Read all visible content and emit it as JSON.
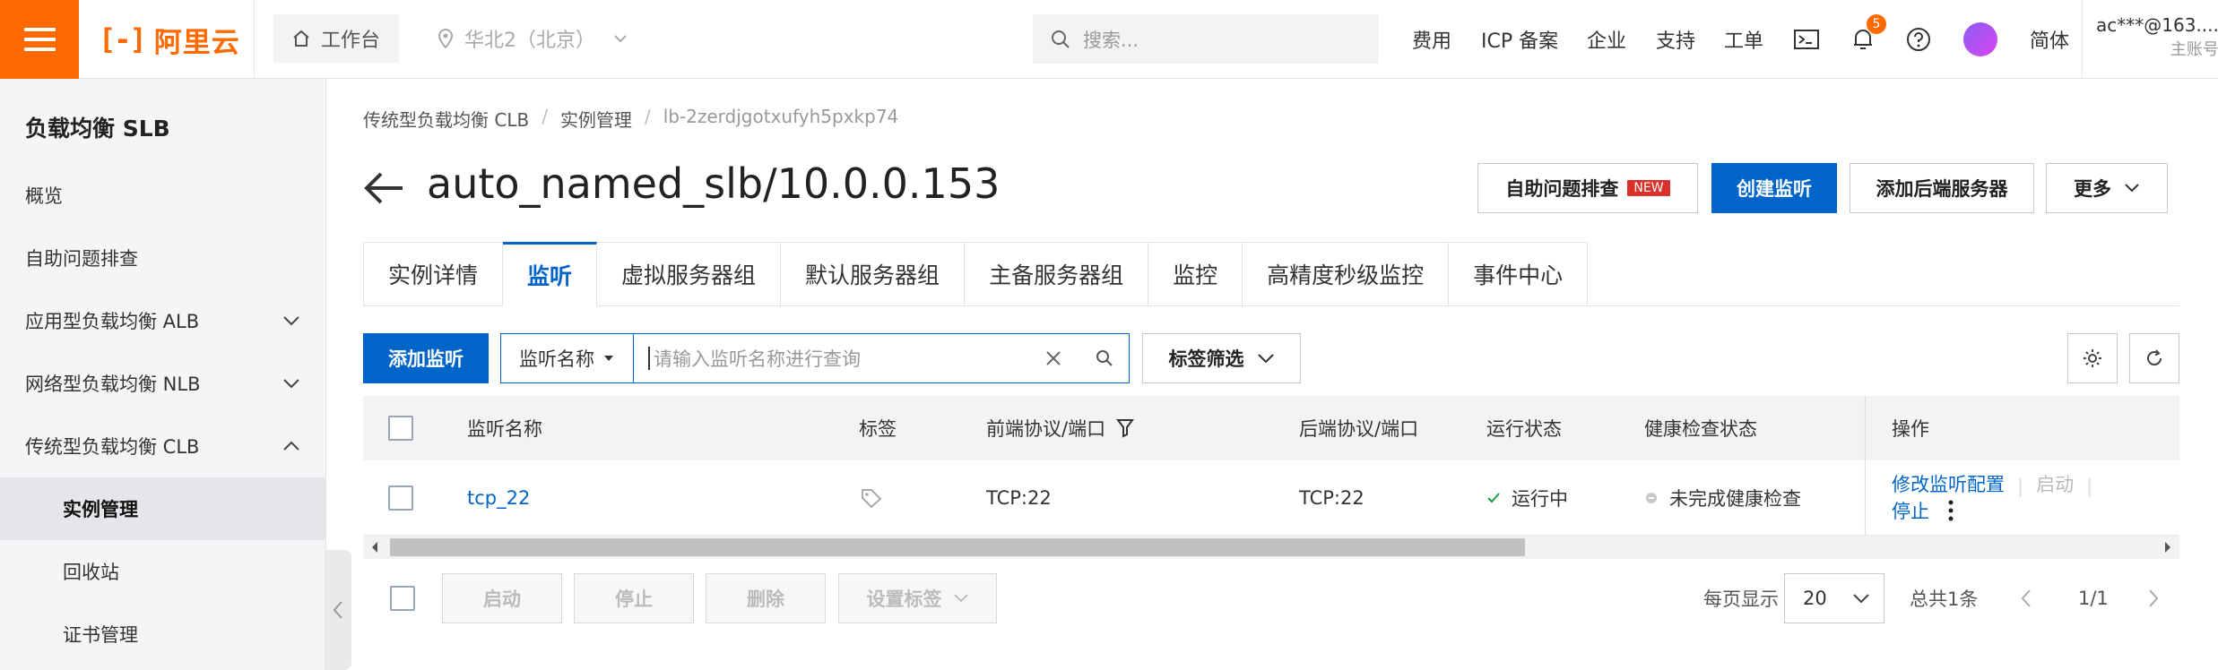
{
  "topbar": {
    "logo_mark": "[-]",
    "logo_text": "阿里云",
    "workbench": "工作台",
    "region": "华北2（北京）",
    "search_placeholder": "搜索...",
    "nav": [
      "费用",
      "ICP 备案",
      "企业",
      "支持",
      "工单"
    ],
    "notification_count": "5",
    "language": "简体",
    "account_name": "ac***@163....",
    "account_type": "主账号"
  },
  "sidebar": {
    "title": "负载均衡 SLB",
    "items": [
      {
        "label": "概览"
      },
      {
        "label": "自助问题排查"
      },
      {
        "label": "应用型负载均衡 ALB"
      },
      {
        "label": "网络型负载均衡 NLB"
      },
      {
        "label": "传统型负载均衡 CLB"
      },
      {
        "label": "实例管理"
      },
      {
        "label": "回收站"
      },
      {
        "label": "证书管理"
      }
    ]
  },
  "breadcrumb": [
    "传统型负载均衡 CLB",
    "实例管理",
    "lb-2zerdjgotxufyh5pxkp74"
  ],
  "page_title": "auto_named_slb/10.0.0.153",
  "header_buttons": {
    "troubleshoot": "自助问题排查",
    "new_tag": "NEW",
    "create_listener": "创建监听",
    "add_backend": "添加后端服务器",
    "more": "更多"
  },
  "tabs": [
    "实例详情",
    "监听",
    "虚拟服务器组",
    "默认服务器组",
    "主备服务器组",
    "监控",
    "高精度秒级监控",
    "事件中心"
  ],
  "toolbar": {
    "add_listener": "添加监听",
    "filter_field": "监听名称",
    "filter_placeholder": "请输入监听名称进行查询",
    "tag_filter": "标签筛选"
  },
  "table": {
    "headers": [
      "监听名称",
      "标签",
      "前端协议/端口",
      "后端协议/端口",
      "运行状态",
      "健康检查状态",
      "操作"
    ],
    "rows": [
      {
        "name": "tcp_22",
        "frontend": "TCP:22",
        "backend": "TCP:22",
        "status": "运行中",
        "health": "未完成健康检查",
        "op_modify": "修改监听配置",
        "op_start": "启动",
        "op_stop": "停止"
      }
    ]
  },
  "footer": {
    "start": "启动",
    "stop": "停止",
    "delete": "删除",
    "set_tags": "设置标签",
    "per_page_label": "每页显示",
    "per_page_value": "20",
    "total": "总共1条",
    "page": "1/1"
  },
  "colors": {
    "brand_orange": "#ff6a00",
    "primary_blue": "#0064c8",
    "status_green": "#1a9e3f"
  }
}
